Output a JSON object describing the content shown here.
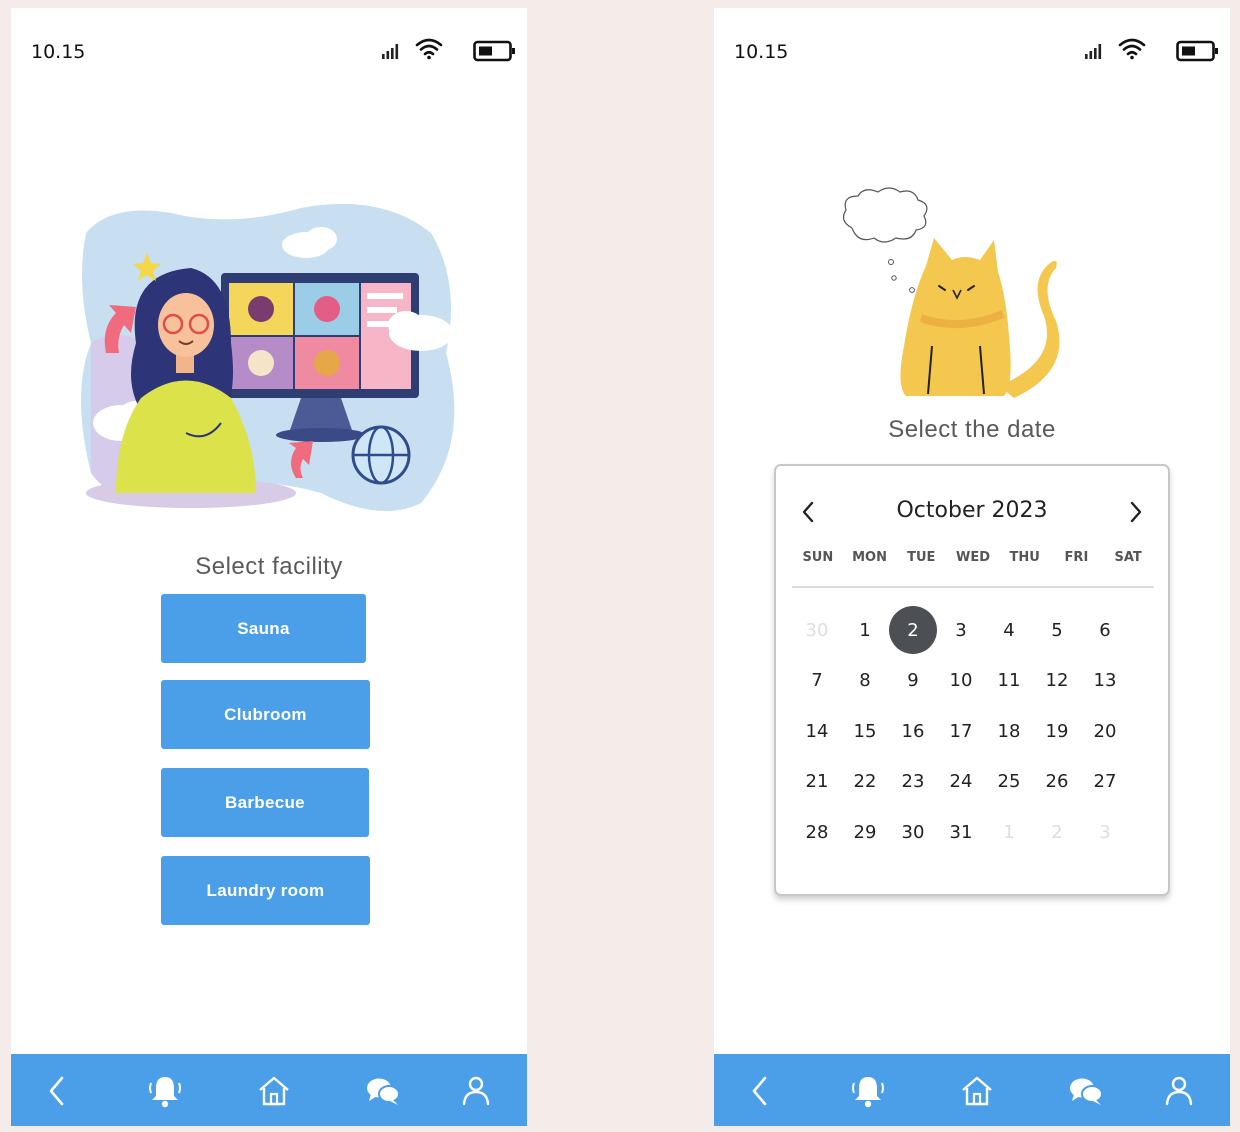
{
  "left_screen": {
    "status": {
      "time": "10.15"
    },
    "title": "Select facility",
    "facilities": [
      {
        "label": "Sauna"
      },
      {
        "label": "Clubroom"
      },
      {
        "label": "Barbecue"
      },
      {
        "label": "Laundry room"
      }
    ]
  },
  "right_screen": {
    "status": {
      "time": "10.15"
    },
    "title": "Select the date",
    "calendar": {
      "month_label": "October 2023",
      "weekdays": [
        "SUN",
        "MON",
        "TUE",
        "WED",
        "THU",
        "FRI",
        "SAT"
      ],
      "weeks": [
        [
          {
            "d": "30",
            "m": true
          },
          {
            "d": "1"
          },
          {
            "d": "2",
            "s": true
          },
          {
            "d": "3"
          },
          {
            "d": "4"
          },
          {
            "d": "5"
          },
          {
            "d": "6"
          }
        ],
        [
          {
            "d": "7"
          },
          {
            "d": "8"
          },
          {
            "d": "9"
          },
          {
            "d": "10"
          },
          {
            "d": "11"
          },
          {
            "d": "12"
          },
          {
            "d": "13"
          }
        ],
        [
          {
            "d": "14"
          },
          {
            "d": "15"
          },
          {
            "d": "16"
          },
          {
            "d": "17"
          },
          {
            "d": "18"
          },
          {
            "d": "19"
          },
          {
            "d": "20"
          }
        ],
        [
          {
            "d": "21"
          },
          {
            "d": "22"
          },
          {
            "d": "23"
          },
          {
            "d": "24"
          },
          {
            "d": "25"
          },
          {
            "d": "26"
          },
          {
            "d": "27"
          }
        ],
        [
          {
            "d": "28"
          },
          {
            "d": "29"
          },
          {
            "d": "30"
          },
          {
            "d": "31"
          },
          {
            "d": "1",
            "m": true
          },
          {
            "d": "2",
            "m": true
          },
          {
            "d": "3",
            "m": true
          }
        ]
      ],
      "selected_date": "2"
    }
  },
  "navbar": {
    "icons": [
      "back-arrow-icon",
      "bell-icon",
      "home-icon",
      "chat-icon",
      "user-icon"
    ]
  },
  "colors": {
    "accent": "#4a9fe8",
    "background": "#f5ecea",
    "selected_day": "#4c4f54"
  }
}
